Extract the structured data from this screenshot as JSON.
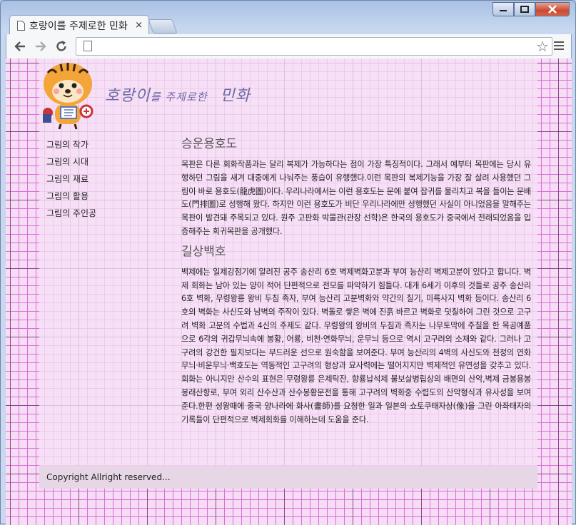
{
  "browser": {
    "tab_title": "호랑이를 주제로한 민화",
    "tab_close": "×",
    "url": ""
  },
  "header": {
    "title_part1": "호랑이",
    "title_small": "를 주제로한",
    "title_part2": "민화"
  },
  "sidebar": {
    "items": [
      {
        "label": "그림의 작가"
      },
      {
        "label": "그림의 시대"
      },
      {
        "label": "그림의 재료"
      },
      {
        "label": "그림의 활용"
      },
      {
        "label": "그림의 주인공"
      }
    ]
  },
  "main": {
    "sections": [
      {
        "heading": "승운용호도",
        "body": "목판은 다른 회화작품과는 달리 복제가 가능하다는 점이 가장 특징적이다. 그래서 예부터 목판에는 당시 유행하던 그림을 새겨 대중에게 나눠주는 풍습이 유행했다.이런 목판의 복제기능을 가장 잘 살려 사용했던 그림이 바로 용호도(龍虎圖)이다. 우리나라에서는 이런 용호도는 문에 붙여 잡귀를 물리치고 복을 들이는 문배도(門排圖)로 성행해 왔다. 하지만 이런 용호도가 비단 우리나라에만 성행했던 사실이 아니었음을 말해주는 목판이 발견돼 주목되고 있다. 원주 고판화 박물관(관장 선학)은 한국의 용호도가 중국에서 전래되었음을 입증해주는 희귀목판을 공개했다."
      },
      {
        "heading": "길상백호",
        "body": "백제에는 일제강점기에 알려진 공주 송산리 6호 벽제벽화고분과 부여 능산리 벽제고분이 있다고 합니다. 벽제 회화는 남아 있는 양이 적어 단편적으로 전모를 파악하기 힘들다. 대개 6세기 이후의 것들로 공주 송산리 6호 벽화, 무령왕릉 왕비 두침 족자, 부여 능산리 고분벽화와 약간의 칠기, 미륵사지 벽화 등이다. 송산리 6호의 벽화는 사신도와 남벽의 주작이 있다. 벽돌로 쌓은 벽에 진흙 바르고 벽화로 덧칠하여 그린 것으로 고구려 벽화 고분의 수법과 4신의 주제도 같다. 무령왕의 왕비의 두침과 족자는 나무토막에 주칠을 한 목공예품으로 6각의 귀갑무늬속에 봉황, 어룡, 비천·연화무늬, 운무늬 등으로 역시 고구려의 소재와 같다. 그러나 고구려의 강건한 필치보다는 부드러운 선으로 원숙함을 보여준다. 부여 능산리의 4벽의 사신도와 천정의 연화무늬·비운무늬·백호도는 역동적인 고구려의 형상과 묘사력에는 떨어지지만 벽제적인 유연성을 갖추고 있다. 회화는 아니지만 산수의 표현은 무령왕릉 은제탁잔, 향룡납석제 불보살병립상의 배면의 산악,벽제 금봉용봉봉래산향로, 부여 외리 산수산과 산수봉황문전을 통해 고구려의 벽화중 수렵도의 산악형식과 유사성을 보여준다.한편 성왕때에 중국 양나라에 화사(畵師)를 요청한 일과 일본의 쇼토쿠태자상(像)을 그린 아좌태자의 기록들이 단편적으로 벽제회화를 이해하는데 도움을 준다."
      }
    ]
  },
  "footer": {
    "copyright": "Copyright Allright reserved..."
  },
  "colors": {
    "grid_minor": "#d86fd6",
    "page_background": "#f6dcf5",
    "title_color": "#6d6aa3"
  }
}
